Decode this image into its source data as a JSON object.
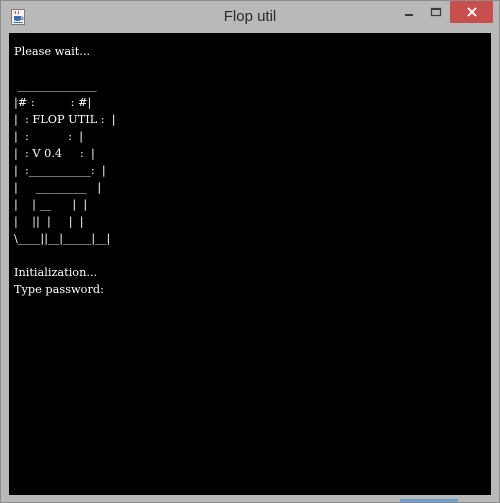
{
  "window": {
    "title": "Flop util",
    "icons": {
      "app": "java-cup-icon",
      "minimize": "minimize-icon",
      "maximize": "maximize-icon",
      "close": "close-icon"
    },
    "colors": {
      "frame": "#b9b9b9",
      "close_button": "#c7504e",
      "console_background": "#000000",
      "console_text": "#ffffff"
    }
  },
  "console": {
    "lines": [
      "Please wait...",
      "",
      " ______________",
      "|# :          : #|",
      "|  : FLOP UTIL :  |",
      "|  :           :  |",
      "|  : V 0.4     :  |",
      "|  :___________:  |",
      "|     _________   |",
      "|    | __      |  |",
      "|    ||  |     |  |",
      "\\____||__|_____|__|",
      "",
      "Initialization...",
      "Type password:"
    ]
  }
}
